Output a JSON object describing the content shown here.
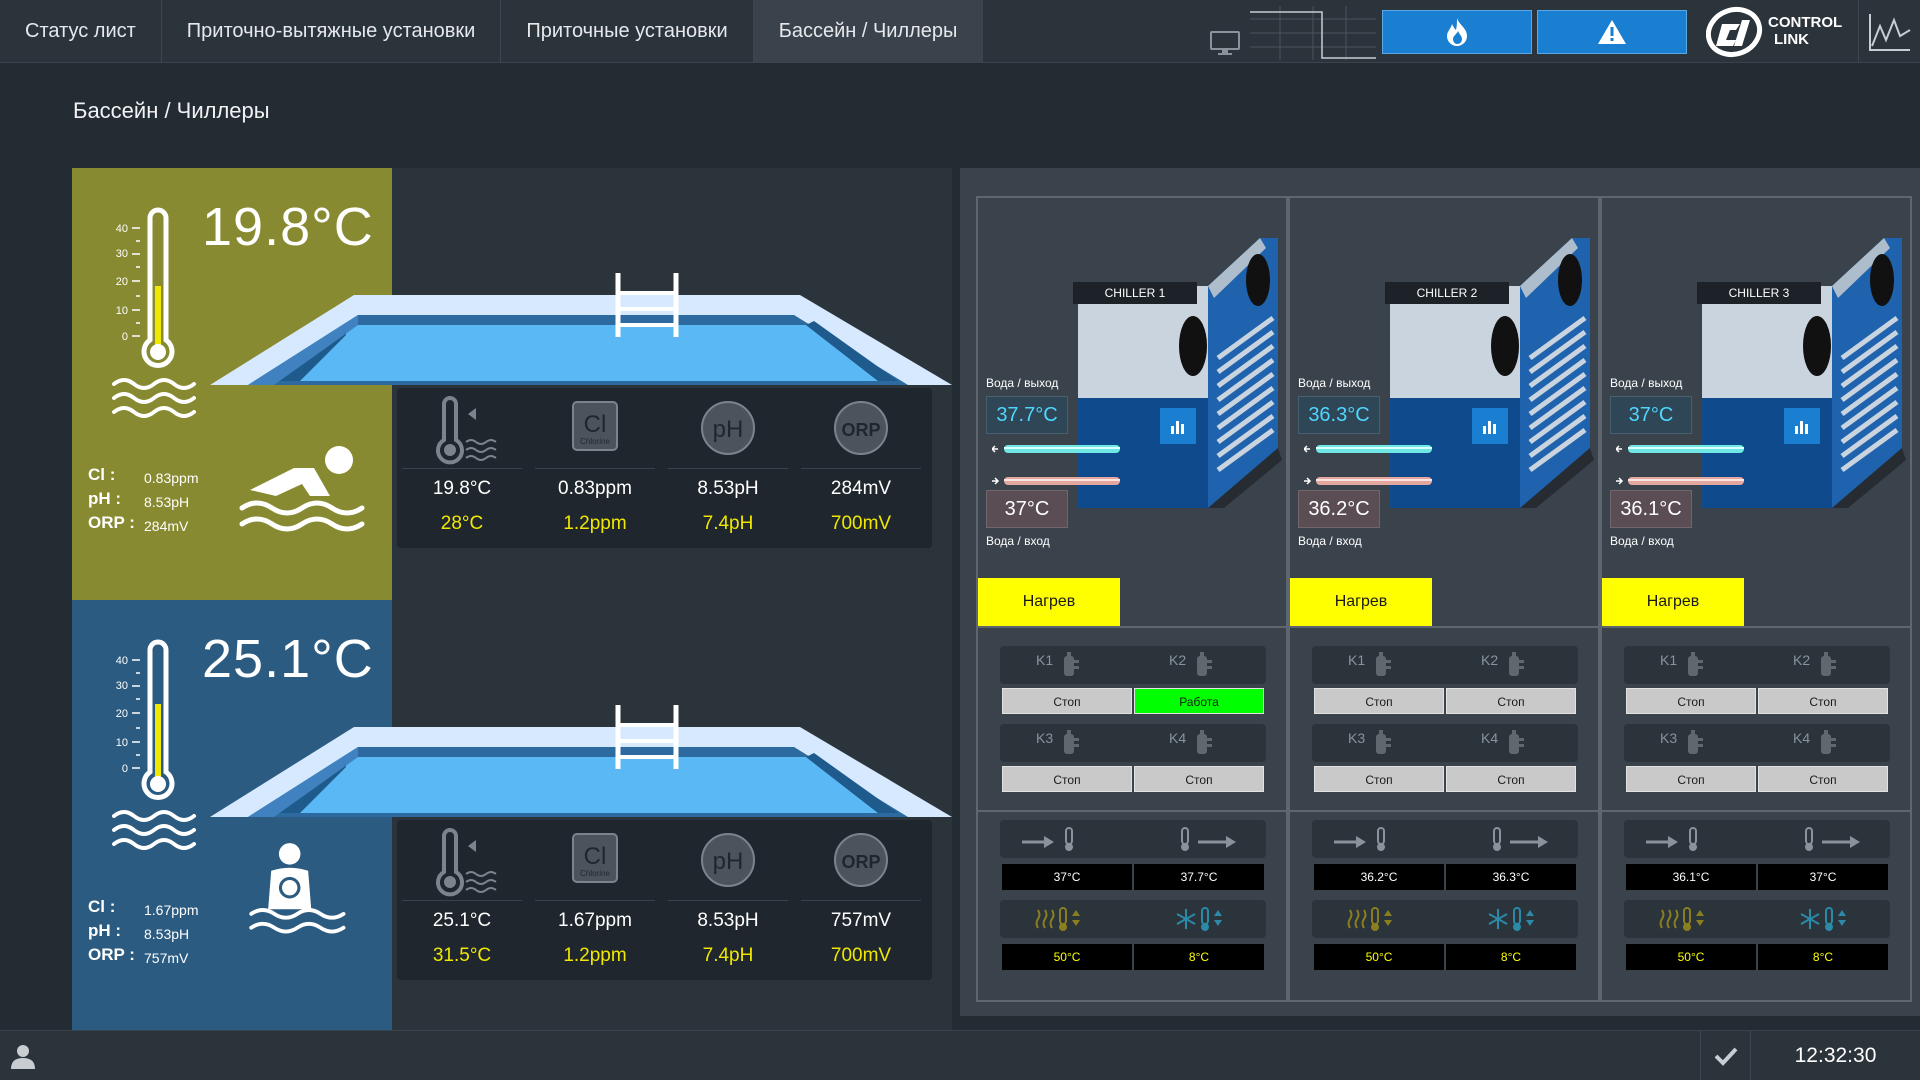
{
  "tabs": [
    {
      "label": "Статус лист"
    },
    {
      "label": "Приточно-вытяжные установки"
    },
    {
      "label": "Приточные установки"
    },
    {
      "label": "Бассейн / Чиллеры",
      "active": true
    }
  ],
  "logo": {
    "line1": "CONTROL",
    "line2": "LINK"
  },
  "page_title": "Бассейн / Чиллеры",
  "pools": [
    {
      "color": "#878a30",
      "water_temp": "19.8°C",
      "thermometer_scale": [
        "40",
        "30",
        "20",
        "10",
        "0"
      ],
      "thermometer_level": 0.45,
      "chem_labels": {
        "cl": "Cl :",
        "ph": "pH :",
        "orp": "ORP :"
      },
      "chem_values": {
        "cl": "0.83ppm",
        "ph": "8.53pH",
        "orp": "284mV"
      },
      "icon": "swimmer-icon",
      "stats": [
        {
          "icon": "water-temperature-icon",
          "actual": "19.8°C",
          "setpoint": "28°C"
        },
        {
          "icon": "chlorine-icon",
          "icon_text": "Cl",
          "icon_sub": "Chlorine",
          "actual": "0.83ppm",
          "setpoint": "1.2ppm"
        },
        {
          "icon": "ph-icon",
          "icon_text": "pH",
          "actual": "8.53pH",
          "setpoint": "7.4pH"
        },
        {
          "icon": "orp-icon",
          "icon_text": "ORP",
          "actual": "284mV",
          "setpoint": "700mV"
        }
      ]
    },
    {
      "color": "#2b5b80",
      "water_temp": "25.1°C",
      "thermometer_scale": [
        "40",
        "30",
        "20",
        "10",
        "0"
      ],
      "thermometer_level": 0.6,
      "chem_labels": {
        "cl": "Cl :",
        "ph": "pH :",
        "orp": "ORP :"
      },
      "chem_values": {
        "cl": "1.67ppm",
        "ph": "8.53pH",
        "orp": "757mV"
      },
      "icon": "child-swimmer-icon",
      "stats": [
        {
          "icon": "water-temperature-icon",
          "actual": "25.1°C",
          "setpoint": "31.5°C"
        },
        {
          "icon": "chlorine-icon",
          "icon_text": "Cl",
          "icon_sub": "Chlorine",
          "actual": "1.67ppm",
          "setpoint": "1.2ppm"
        },
        {
          "icon": "ph-icon",
          "icon_text": "pH",
          "actual": "8.53pH",
          "setpoint": "7.4pH"
        },
        {
          "icon": "orp-icon",
          "icon_text": "ORP",
          "actual": "757mV",
          "setpoint": "700mV"
        }
      ]
    }
  ],
  "chillers": [
    {
      "name": "CHILLER 1",
      "water_out_label": "Вода / выход",
      "water_in_label": "Вода / вход",
      "water_out": "37.7°C",
      "water_in": "37°C",
      "mode": "Нагрев",
      "compressors": [
        {
          "label": "K1",
          "status": "Стоп",
          "running": false
        },
        {
          "label": "K2",
          "status": "Работа",
          "running": true
        },
        {
          "label": "K3",
          "status": "Стоп",
          "running": false
        },
        {
          "label": "K4",
          "status": "Стоп",
          "running": false
        }
      ],
      "inlet_temp": "37°C",
      "outlet_temp": "37.7°C",
      "heat_setpoint": "50°C",
      "cool_setpoint": "8°C"
    },
    {
      "name": "CHILLER 2",
      "water_out_label": "Вода / выход",
      "water_in_label": "Вода / вход",
      "water_out": "36.3°C",
      "water_in": "36.2°C",
      "mode": "Нагрев",
      "compressors": [
        {
          "label": "K1",
          "status": "Стоп",
          "running": false
        },
        {
          "label": "K2",
          "status": "Стоп",
          "running": false
        },
        {
          "label": "K3",
          "status": "Стоп",
          "running": false
        },
        {
          "label": "K4",
          "status": "Стоп",
          "running": false
        }
      ],
      "inlet_temp": "36.2°C",
      "outlet_temp": "36.3°C",
      "heat_setpoint": "50°C",
      "cool_setpoint": "8°C"
    },
    {
      "name": "CHILLER 3",
      "water_out_label": "Вода / выход",
      "water_in_label": "Вода / вход",
      "water_out": "37°C",
      "water_in": "36.1°C",
      "mode": "Нагрев",
      "compressors": [
        {
          "label": "K1",
          "status": "Стоп",
          "running": false
        },
        {
          "label": "K2",
          "status": "Стоп",
          "running": false
        },
        {
          "label": "K3",
          "status": "Стоп",
          "running": false
        },
        {
          "label": "K4",
          "status": "Стоп",
          "running": false
        }
      ],
      "inlet_temp": "36.1°C",
      "outlet_temp": "37°C",
      "heat_setpoint": "50°C",
      "cool_setpoint": "8°C"
    }
  ],
  "footer": {
    "clock": "12:32:30"
  },
  "colors": {
    "accent": "#1a7fd0",
    "setpoint": "#f0e800",
    "mode": "#ffff00",
    "running": "#00ff00",
    "stopped": "#c9c9c9"
  }
}
